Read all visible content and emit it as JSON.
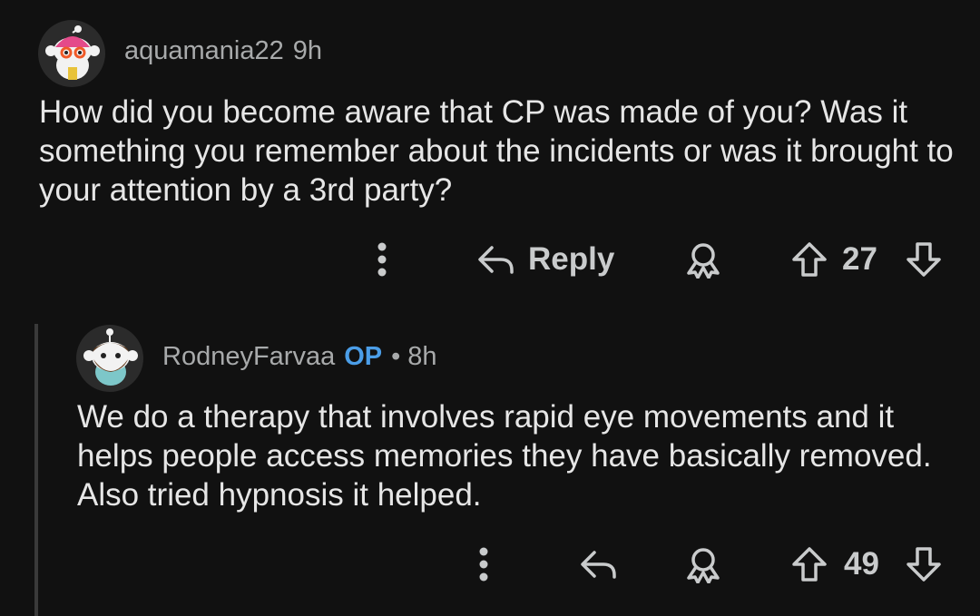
{
  "comments": [
    {
      "author": "aquamania22",
      "time": "9h",
      "body": "How did you become aware that CP was made of you? Was it something you remember about the incidents or was it brought to your attention by a 3rd party?",
      "reply_label": "Reply",
      "votes": "27",
      "icons": [
        "more-vertical-icon",
        "reply-arrow-icon",
        "award-icon",
        "upvote-icon",
        "downvote-icon"
      ]
    },
    {
      "author": "RodneyFarvaa",
      "op_badge": "OP",
      "separator": "•",
      "time": "8h",
      "body": "We do a therapy that involves rapid eye movements and it helps people access memories they have basically removed. Also tried hypnosis it helped.",
      "votes": "49",
      "icons": [
        "more-vertical-icon",
        "reply-arrow-icon",
        "award-icon",
        "upvote-icon",
        "downvote-icon"
      ]
    }
  ],
  "colors": {
    "background": "#111111",
    "text": "#e6e6e6",
    "meta": "#a8aaab",
    "op": "#4b9ee8"
  }
}
